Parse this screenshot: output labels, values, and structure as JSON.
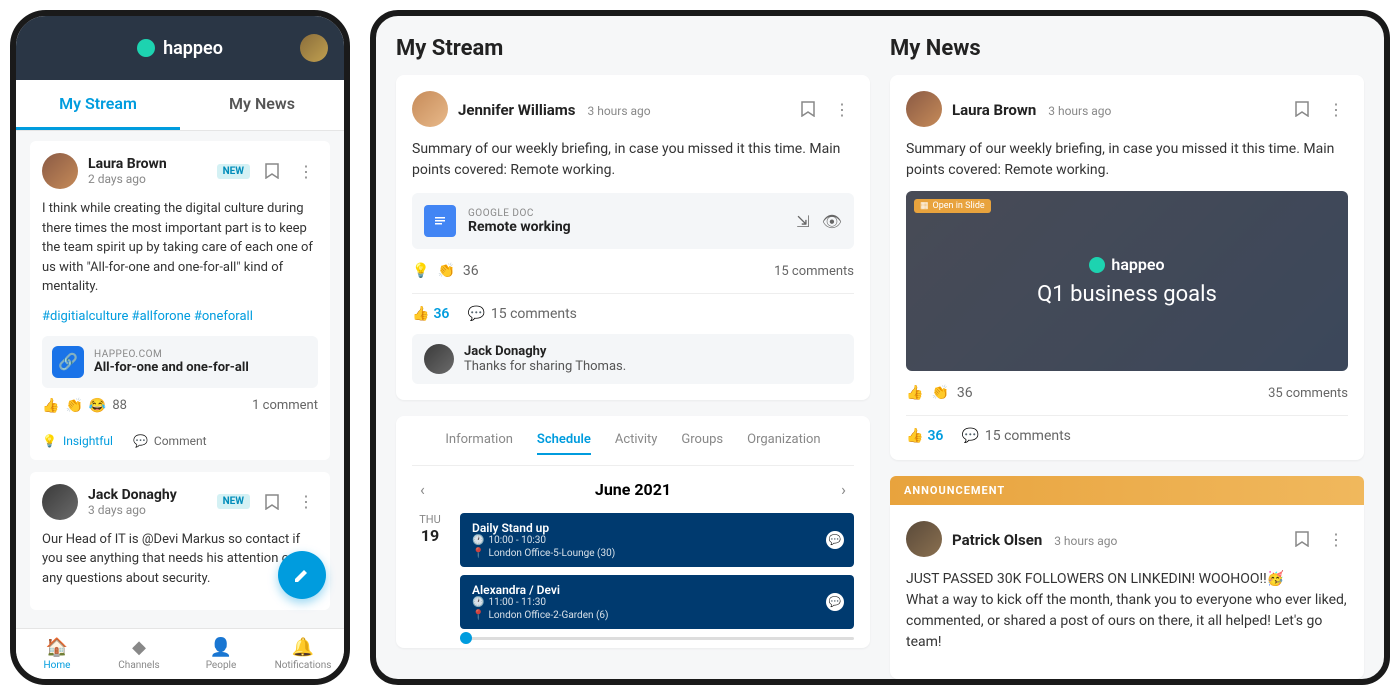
{
  "brand": "happeo",
  "mobile": {
    "tabs": {
      "stream": "My Stream",
      "news": "My News"
    },
    "posts": [
      {
        "author": "Laura Brown",
        "time": "2 days ago",
        "new": "NEW",
        "body": "I think while creating the digital culture during there times the most important part is to keep the team spirit up by taking care of each one of us with \"All-for-one and one-for-all\" kind of mentality.",
        "hashtags": "#digitialculture #allforone #oneforall",
        "link_domain": "HAPPEO.COM",
        "link_title": "All-for-one and one-for-all",
        "reactions_count": "88",
        "comments": "1 comment",
        "action_insightful": "Insightful",
        "action_comment": "Comment"
      },
      {
        "author": "Jack Donaghy",
        "time": "3 days ago",
        "new": "NEW",
        "body": "Our Head of IT is @Devi Markus so contact if you see anything that needs his attention or if any questions about security."
      }
    ],
    "nav": {
      "home": "Home",
      "channels": "Channels",
      "people": "People",
      "notifications": "Notifications"
    }
  },
  "tablet": {
    "stream": {
      "title": "My Stream",
      "post": {
        "author": "Jennifer Williams",
        "time": "3 hours ago",
        "body": "Summary of our weekly briefing, in case you missed it this time. Main points covered: Remote working.",
        "doc_label": "GOOGLE DOC",
        "doc_title": "Remote working",
        "reactions_count": "36",
        "comments_inline": "15 comments",
        "like_count": "36",
        "comments_footer": "15 comments",
        "commenter_name": "Jack Donaghy",
        "commenter_text": "Thanks for sharing Thomas."
      },
      "schedule": {
        "tabs": {
          "info": "Information",
          "sched": "Schedule",
          "activity": "Activity",
          "groups": "Groups",
          "org": "Organization"
        },
        "month": "June 2021",
        "day_label": "THU",
        "day_num": "19",
        "events": [
          {
            "title": "Daily Stand up",
            "time": "10:00 - 10:30",
            "loc": "London Office-5-Lounge (30)"
          },
          {
            "title": "Alexandra / Devi",
            "time": "11:00 - 11:30",
            "loc": "London Office-2-Garden (6)"
          }
        ]
      }
    },
    "news": {
      "title": "My News",
      "post": {
        "author": "Laura Brown",
        "time": "3 hours ago",
        "body": "Summary of our weekly briefing, in case you missed it this time. Main points covered: Remote working.",
        "slide_badge": "Open in Slide",
        "media_title": "Q1 business goals",
        "reactions_count": "36",
        "comments_inline": "35 comments",
        "like_count": "36",
        "comments_footer": "15 comments"
      },
      "announcement": {
        "label": "ANNOUNCEMENT",
        "author": "Patrick Olsen",
        "time": "3 hours ago",
        "body": "JUST PASSED 30K FOLLOWERS ON LINKEDIN! WOOHOO!!🥳\nWhat a way to kick off the month, thank you to everyone who ever liked, commented, or shared a post of ours on there, it all helped! Let's go team!"
      }
    }
  }
}
